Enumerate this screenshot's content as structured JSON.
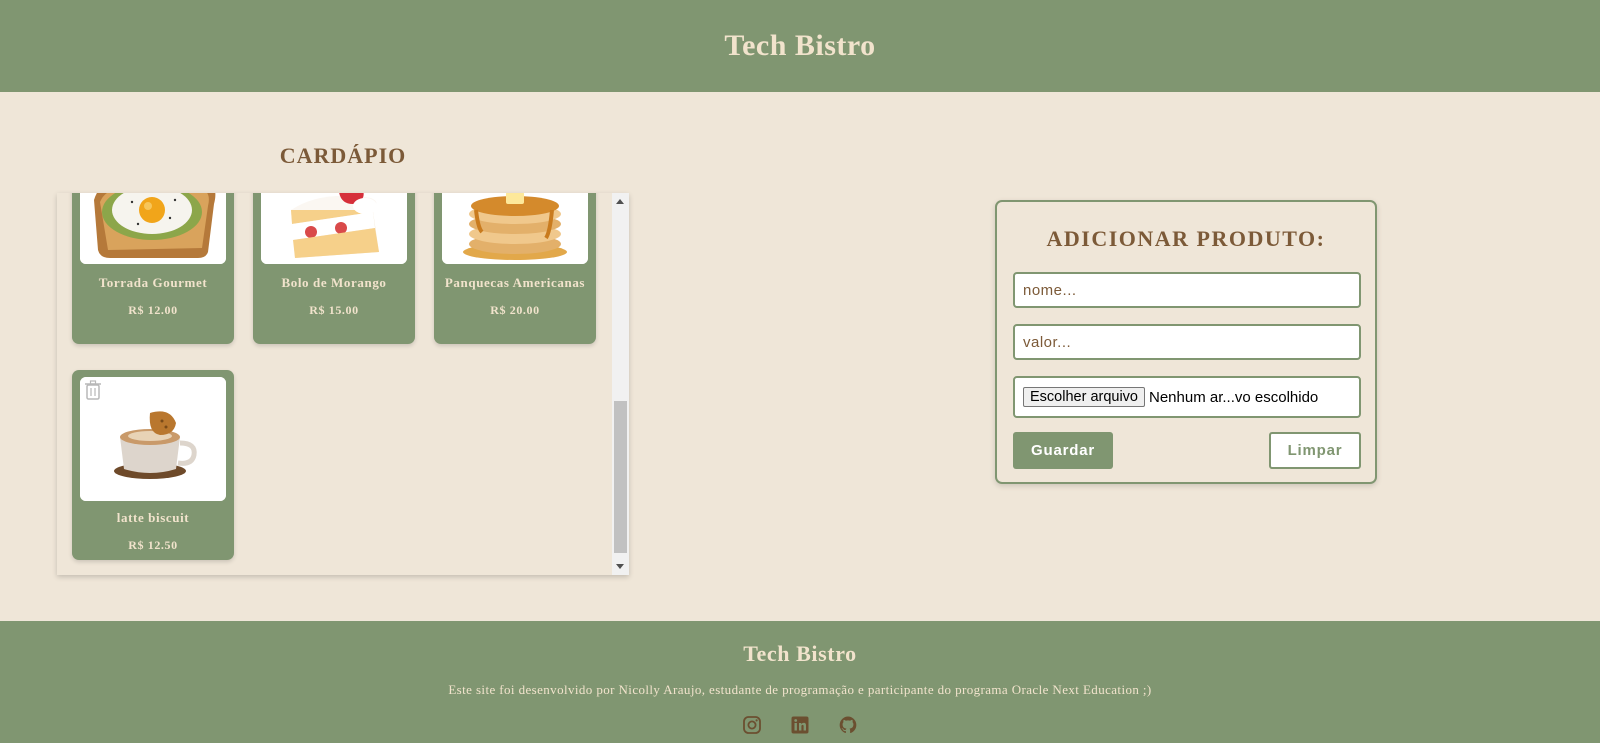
{
  "header": {
    "title": "Tech Bistro"
  },
  "menu": {
    "title": "CARDÁPIO",
    "items": [
      {
        "name": "Torrada Gourmet",
        "price": "R$ 12.00",
        "image": "avocado-toast-egg"
      },
      {
        "name": "Bolo de Morango",
        "price": "R$ 15.00",
        "image": "strawberry-cake-slice"
      },
      {
        "name": "Panquecas Americanas",
        "price": "R$ 20.00",
        "image": "pancake-stack"
      },
      {
        "name": "latte biscuit",
        "price": "R$ 12.50",
        "image": "latte-cup-biscuit"
      }
    ]
  },
  "form": {
    "title": "ADICIONAR PRODUTO:",
    "name_placeholder": "nome...",
    "value_placeholder": "valor...",
    "file_button": "Escolher arquivo",
    "file_status": "Nenhum ar...vo escolhido",
    "save_label": "Guardar",
    "clear_label": "Limpar"
  },
  "footer": {
    "title": "Tech Bistro",
    "description": "Este site foi desenvolvido por Nicolly Araujo, estudante de programação e participante do programa Oracle Next Education ;)",
    "socials": [
      "instagram-icon",
      "linkedin-icon",
      "github-icon"
    ]
  },
  "colors": {
    "primary": "#809671",
    "background": "#efe6d8",
    "title_brown": "#7c5a38",
    "cream_text": "#f1e3cc"
  }
}
